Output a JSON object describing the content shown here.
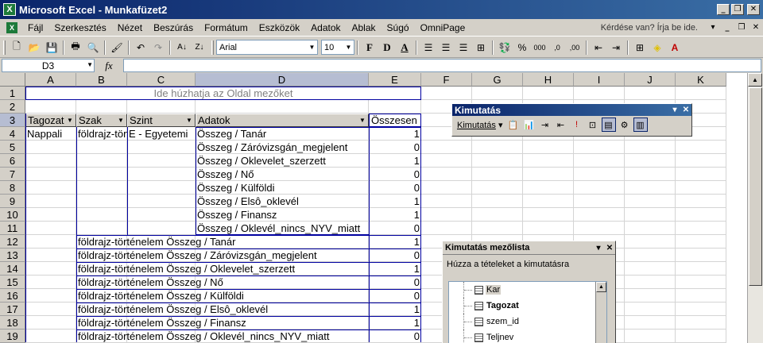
{
  "window": {
    "title": "Microsoft Excel - Munkafüzet2",
    "app_icon": "excel-icon"
  },
  "menu": {
    "items": [
      "Fájl",
      "Szerkesztés",
      "Nézet",
      "Beszúrás",
      "Formátum",
      "Eszközök",
      "Adatok",
      "Ablak",
      "Súgó",
      "OmniPage"
    ],
    "help_placeholder": "Kérdése van? Írja be ide."
  },
  "toolbar": {
    "font_name": "Arial",
    "font_size": "10",
    "bold": "F",
    "italic": "D",
    "underline": "A",
    "percent": "%",
    "thousands": "000"
  },
  "formula_bar": {
    "cell_ref": "D3",
    "fx": "fx",
    "value": ""
  },
  "sheet": {
    "columns": [
      "A",
      "B",
      "C",
      "D",
      "E",
      "F",
      "G",
      "H",
      "I",
      "J",
      "K"
    ],
    "rows": [
      "1",
      "2",
      "3",
      "4",
      "5",
      "6",
      "7",
      "8",
      "9",
      "10",
      "11",
      "12",
      "13",
      "14",
      "15",
      "16",
      "17",
      "18",
      "19"
    ],
    "selected_column": "D",
    "selected_row": "3",
    "page_field_drop": "Ide húzhatja az Oldal mezőket",
    "header_fields": {
      "tagozat": "Tagozat",
      "szak": "Szak",
      "szint": "Szint",
      "adatok": "Adatok",
      "osszesen": "Összesen"
    },
    "a4": "Nappali",
    "b4": "földrajz-tört",
    "c4": "E - Egyetemi",
    "detail_rows": [
      {
        "label": "Összeg / Tanár",
        "value": "1"
      },
      {
        "label": "Összeg / Záróvizsgán_megjelent",
        "value": "0"
      },
      {
        "label": "Összeg / Oklevelet_szerzett",
        "value": "1"
      },
      {
        "label": "Összeg / Nő",
        "value": "0"
      },
      {
        "label": "Összeg / Külföldi",
        "value": "0"
      },
      {
        "label": "Összeg / Elsô_oklevél",
        "value": "1"
      },
      {
        "label": "Összeg / Finansz",
        "value": "1"
      },
      {
        "label": "Összeg / Oklevél_nincs_NYV_miatt",
        "value": "0"
      }
    ],
    "total_rows": [
      {
        "label": "földrajz-történelem Összeg / Tanár",
        "value": "1"
      },
      {
        "label": "földrajz-történelem Összeg / Záróvizsgán_megjelent",
        "value": "0"
      },
      {
        "label": "földrajz-történelem Összeg / Oklevelet_szerzett",
        "value": "1"
      },
      {
        "label": "földrajz-történelem Összeg / Nő",
        "value": "0"
      },
      {
        "label": "földrajz-történelem Összeg / Külföldi",
        "value": "0"
      },
      {
        "label": "földrajz-történelem Összeg / Elsô_oklevél",
        "value": "1"
      },
      {
        "label": "földrajz-történelem Összeg / Finansz",
        "value": "1"
      },
      {
        "label": "földrajz-történelem Összeg / Oklevél_nincs_NYV_miatt",
        "value": "0"
      }
    ]
  },
  "pivot_toolbar": {
    "title": "Kimutatás",
    "menu_label": "Kimutatás"
  },
  "field_list": {
    "title": "Kimutatás mezőlista",
    "hint": "Húzza a tételeket a kimutatásra",
    "fields": [
      "Kar",
      "Tagozat",
      "szem_id",
      "Teljnev"
    ]
  }
}
